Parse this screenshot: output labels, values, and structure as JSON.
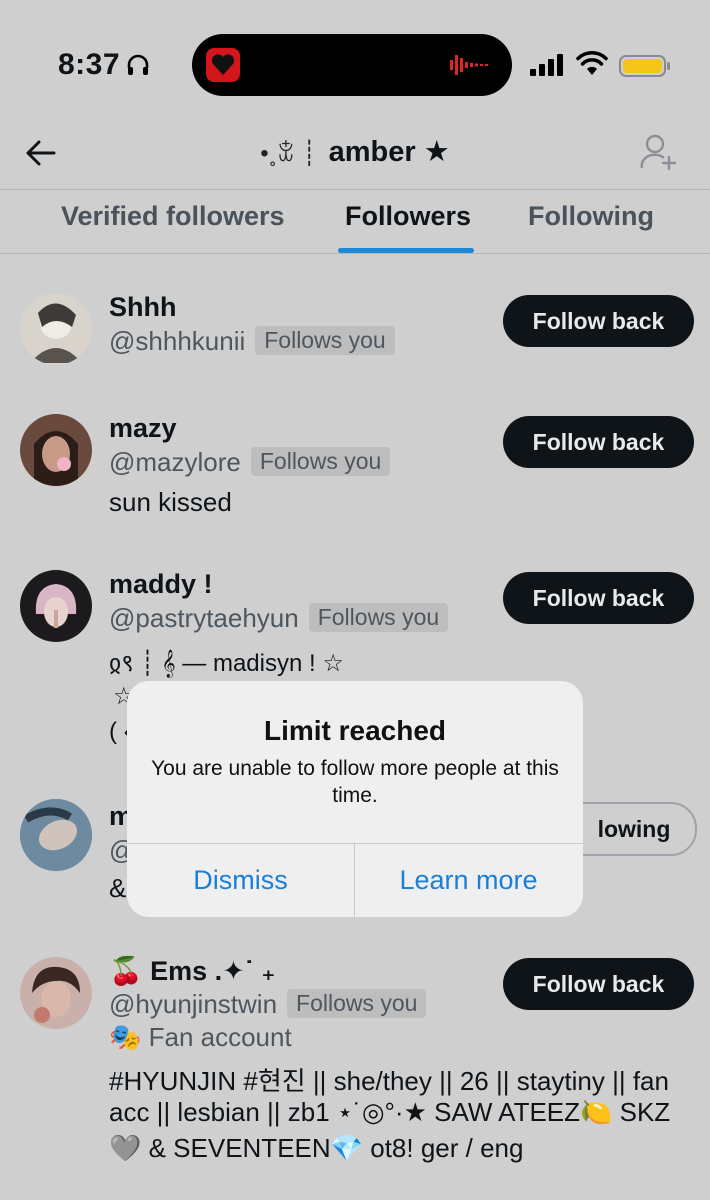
{
  "status_bar": {
    "time": "8:37"
  },
  "header": {
    "title_prefix": "•˳ꒃ ┊",
    "title": "amber ★"
  },
  "tabs": [
    {
      "label": "Verified followers",
      "active": false
    },
    {
      "label": "Followers",
      "active": true
    },
    {
      "label": "Following",
      "active": false
    }
  ],
  "rows": [
    {
      "name": "Shhh",
      "handle": "@shhhkunii",
      "badge": "Follows you",
      "bio": [],
      "button": "Follow back"
    },
    {
      "name": "mazy",
      "handle": "@mazylore",
      "badge": "Follows you",
      "bio": [
        "sun kissed"
      ],
      "button": "Follow back"
    },
    {
      "name": "maddy !",
      "handle": "@pastrytaehyun",
      "badge": "Follows you",
      "bio": [
        "ჲ९ ┊ 𝄞 — madisyn ! ☆",
        "☆",
        "( ‹"
      ],
      "button": "Follow back"
    },
    {
      "name": "m",
      "handle": "@",
      "badge": "",
      "bio": [
        "&"
      ],
      "button": "lowing"
    },
    {
      "name": "🍒 Ems .✦˙ ₊",
      "handle": "@hyunjinstwin",
      "badge": "Follows you",
      "bio": [
        "🎭 Fan account",
        "#HYUNJIN #현진 || she/they || 26 || staytiny || fan",
        "acc || lesbian || zb1 ⋆˙◎°·★ SAW ATEEZ🍋 SKZ",
        "🩶 & SEVENTEEN💎 ot8! ger / eng"
      ],
      "button": "Follow back"
    }
  ],
  "modal": {
    "title": "Limit reached",
    "message": "You are unable to follow more people at this time.",
    "dismiss": "Dismiss",
    "learn_more": "Learn more"
  },
  "colors": {
    "accent": "#1d87d8",
    "button_dark": "#0f1419",
    "overlay_bg": "#cfcfcf",
    "island_app": "#d2161c",
    "battery": "#f5c518"
  }
}
